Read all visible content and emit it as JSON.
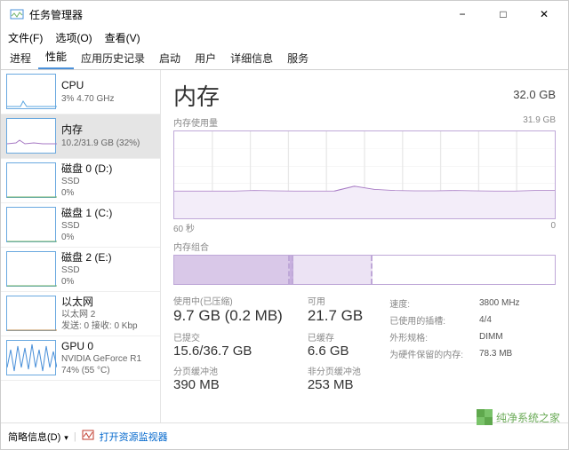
{
  "window": {
    "title": "任务管理器",
    "menu": [
      "文件(F)",
      "选项(O)",
      "查看(V)"
    ],
    "tabs": [
      "进程",
      "性能",
      "应用历史记录",
      "启动",
      "用户",
      "详细信息",
      "服务"
    ],
    "active_tab": 1
  },
  "sidebar": [
    {
      "name": "CPU",
      "sub1": "3%  4.70 GHz",
      "color": "#5aa6e0",
      "shape": "cpu"
    },
    {
      "name": "内存",
      "sub1": "10.2/31.9 GB (32%)",
      "color": "#a77ac4",
      "shape": "mem",
      "selected": true
    },
    {
      "name": "磁盘 0 (D:)",
      "sub1": "SSD",
      "sub2": "0%",
      "color": "#6fb266",
      "shape": "flat"
    },
    {
      "name": "磁盘 1 (C:)",
      "sub1": "SSD",
      "sub2": "0%",
      "color": "#6fb266",
      "shape": "flat"
    },
    {
      "name": "磁盘 2 (E:)",
      "sub1": "SSD",
      "sub2": "0%",
      "color": "#6fb266",
      "shape": "flat"
    },
    {
      "name": "以太网",
      "sub1": "以太网 2",
      "sub2": "发送: 0  接收: 0 Kbp",
      "color": "#c28a4a",
      "shape": "flat"
    },
    {
      "name": "GPU 0",
      "sub1": "NVIDIA GeForce R1",
      "sub2": "74%  (55 °C)",
      "color": "#4a90d9",
      "shape": "gpu"
    }
  ],
  "main": {
    "heading": "内存",
    "total": "32.0 GB",
    "usage_label": "内存使用量",
    "usage_max": "31.9 GB",
    "time_left": "60 秒",
    "time_right": "0",
    "compo_label": "内存组合",
    "stats_left": [
      {
        "lbl": "使用中(已压缩)",
        "val": "9.7 GB (0.2 MB)"
      },
      {
        "lbl": "已提交",
        "val": "15.6/36.7 GB",
        "sm": true
      },
      {
        "lbl": "分页缓冲池",
        "val": "390 MB",
        "sm": true
      }
    ],
    "stats_mid": [
      {
        "lbl": "可用",
        "val": "21.7 GB"
      },
      {
        "lbl": "已缓存",
        "val": "6.6 GB",
        "sm": true
      },
      {
        "lbl": "非分页缓冲池",
        "val": "253 MB",
        "sm": true
      }
    ],
    "info": [
      [
        "速度:",
        "3800 MHz"
      ],
      [
        "已使用的插槽:",
        "4/4"
      ],
      [
        "外形规格:",
        "DIMM"
      ],
      [
        "为硬件保留的内存:",
        "78.3 MB"
      ]
    ]
  },
  "bottom": {
    "fewer": "简略信息(D)",
    "resmon": "打开资源监视器"
  },
  "watermark": "纯净系统之家",
  "watermark_url": "ycwjzy.com",
  "chart_data": {
    "type": "area",
    "title": "内存使用量",
    "ylabel": "GB",
    "ylim": [
      0,
      31.9
    ],
    "xlim_label": [
      "60 秒",
      "0"
    ],
    "series": [
      {
        "name": "使用中",
        "values": [
          10.0,
          10.0,
          10.0,
          10.0,
          10.2,
          10.1,
          10.0,
          10.0,
          10.0,
          11.8,
          10.6,
          10.2,
          10.1,
          10.1,
          10.2,
          10.1,
          10.0,
          10.0,
          10.2,
          10.2
        ]
      }
    ],
    "composition": {
      "in_use_gb": 9.7,
      "modified_gb": 0.3,
      "standby_gb": 6.6,
      "free_gb": 15.3,
      "total_gb": 31.9
    }
  }
}
